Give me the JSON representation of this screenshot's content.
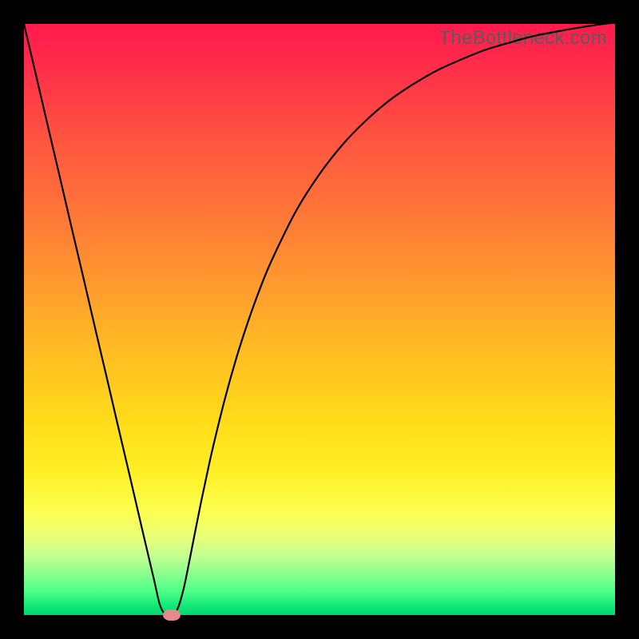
{
  "watermark": "TheBottleneck.com",
  "colors": {
    "frame": "#000000",
    "curve": "#000000",
    "marker": "#e48a8a"
  },
  "chart_data": {
    "type": "line",
    "title": "",
    "xlabel": "",
    "ylabel": "",
    "xlim": [
      0,
      100
    ],
    "ylim": [
      0,
      100
    ],
    "grid": false,
    "x": [
      0,
      2,
      4,
      6,
      8,
      10,
      12,
      14,
      16,
      18,
      20,
      22,
      23,
      24,
      25,
      26,
      27,
      28,
      29,
      30,
      31,
      32,
      34,
      36,
      38,
      40,
      42,
      46,
      50,
      54,
      58,
      62,
      66,
      70,
      74,
      78,
      82,
      86,
      90,
      94,
      98,
      100
    ],
    "values": [
      100.0,
      91.5,
      82.9,
      74.4,
      65.8,
      57.3,
      48.7,
      40.2,
      31.6,
      23.1,
      14.5,
      6.0,
      1.7,
      0.0,
      0.0,
      1.1,
      4.4,
      9.2,
      14.3,
      19.3,
      24.0,
      28.5,
      36.6,
      43.7,
      49.9,
      55.4,
      60.2,
      68.3,
      74.6,
      79.7,
      83.8,
      87.2,
      89.9,
      92.2,
      94.0,
      95.6,
      96.8,
      97.9,
      98.7,
      99.4,
      100.0,
      100.2
    ],
    "marker": {
      "x": 25,
      "y": 0
    }
  }
}
